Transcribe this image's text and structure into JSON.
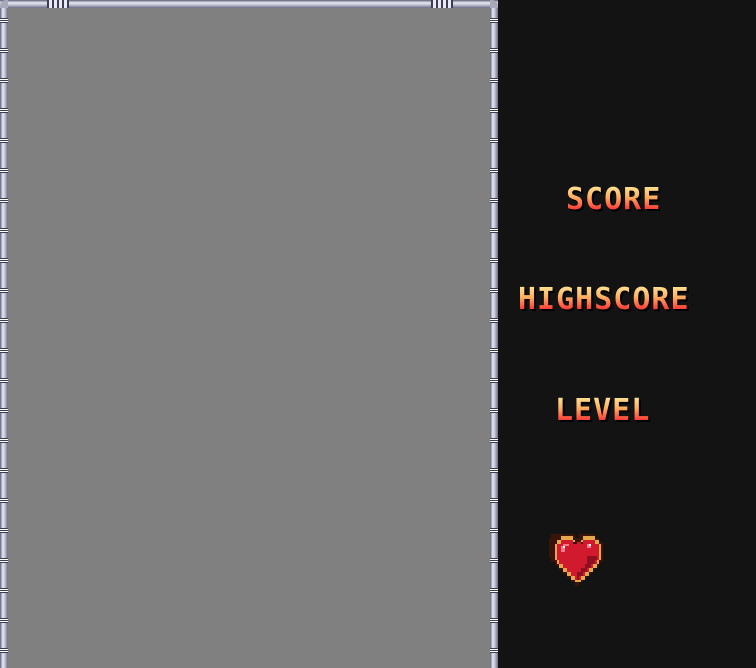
{
  "hud": {
    "score_label": "SCORE",
    "highscore_label": "HIGHSCORE",
    "level_label": "LEVEL"
  },
  "lives": {
    "count": 1,
    "icon": "heart-icon"
  },
  "colors": {
    "background": "#131313",
    "playfield": "#808080",
    "label_top": "#ffe89a",
    "label_bottom": "#c81a2a",
    "heart": "#d11a2e"
  }
}
